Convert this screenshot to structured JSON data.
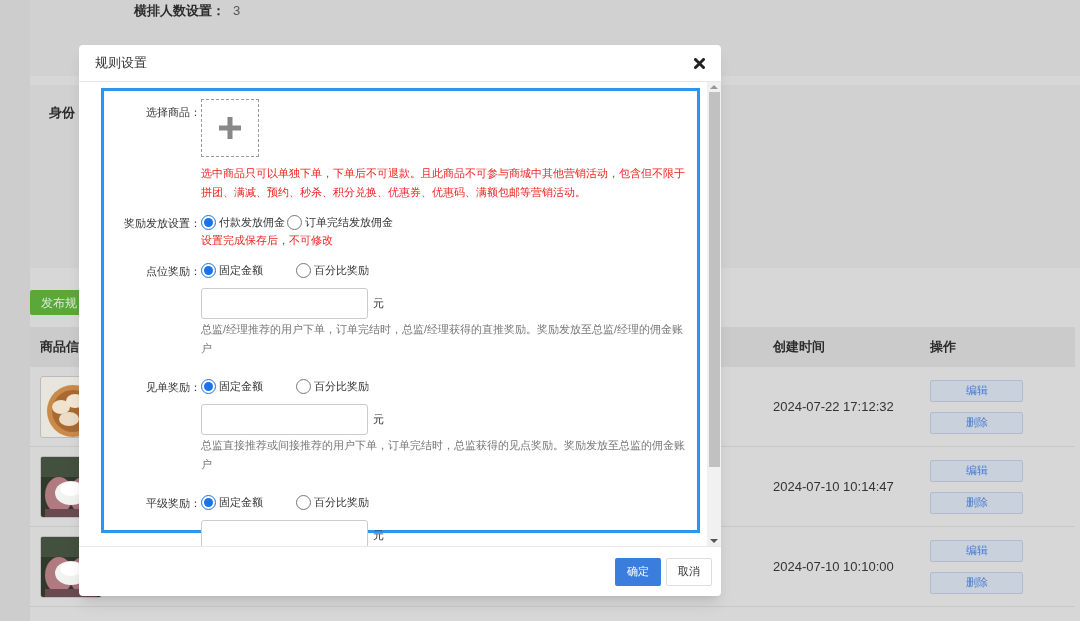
{
  "background": {
    "settings": [
      {
        "label": "横排人数设置：",
        "value": "3"
      }
    ],
    "section_label": "身份",
    "publish_button": "发布规",
    "table": {
      "columns": [
        "商品信",
        "创建时间",
        "操作"
      ],
      "rows": [
        {
          "thumbnail": {
            "kind": "picture"
          },
          "created": "2024-07-22 17:12:32",
          "actions": [
            "编辑",
            "删除"
          ]
        },
        {
          "thumbnail": {
            "kind": "picture"
          },
          "created": "2024-07-10 10:14:47",
          "actions": [
            "编辑",
            "删除"
          ]
        },
        {
          "thumbnail": {
            "kind": "picture"
          },
          "created": "2024-07-10 10:10:00",
          "actions": [
            "编辑",
            "删除"
          ]
        }
      ]
    }
  },
  "dialog": {
    "title": "规则设置",
    "fields": [
      {
        "kind": "product",
        "label": "选择商品：",
        "notice": "选中商品只可以单独下单，下单后不可退款。且此商品不可参与商城中其他营销活动，包含但不限于拼团、满减、预约、秒杀、积分兑换、优惠券、优惠码、满额包邮等营销活动。"
      },
      {
        "kind": "radio",
        "label": "奖励发放设置：",
        "options": [
          {
            "label": "付款发放佣金",
            "selected": true
          },
          {
            "label": "订单完结发放佣金",
            "selected": false
          }
        ],
        "notice": "设置完成保存后，不可修改"
      },
      {
        "kind": "amount",
        "label": "点位奖励：",
        "options": [
          {
            "label": "固定金额",
            "selected": true
          },
          {
            "label": "百分比奖励",
            "selected": false
          }
        ],
        "unit": "元",
        "help": "总监/经理推荐的用户下单，订单完结时，总监/经理获得的直推奖励。奖励发放至总监/经理的佣金账户"
      },
      {
        "kind": "amount",
        "label": "见单奖励：",
        "options": [
          {
            "label": "固定金额",
            "selected": true
          },
          {
            "label": "百分比奖励",
            "selected": false
          }
        ],
        "unit": "元",
        "help": "总监直接推荐或间接推荐的用户下单，订单完结时，总监获得的见点奖励。奖励发放至总监的佣金账户"
      },
      {
        "kind": "amount",
        "label": "平级奖励：",
        "options": [
          {
            "label": "固定金额",
            "selected": true
          },
          {
            "label": "百分比奖励",
            "selected": false
          }
        ],
        "unit": "元"
      }
    ],
    "buttons": [
      {
        "label": "确定",
        "primary": true
      },
      {
        "label": "取消",
        "primary": false
      }
    ]
  }
}
